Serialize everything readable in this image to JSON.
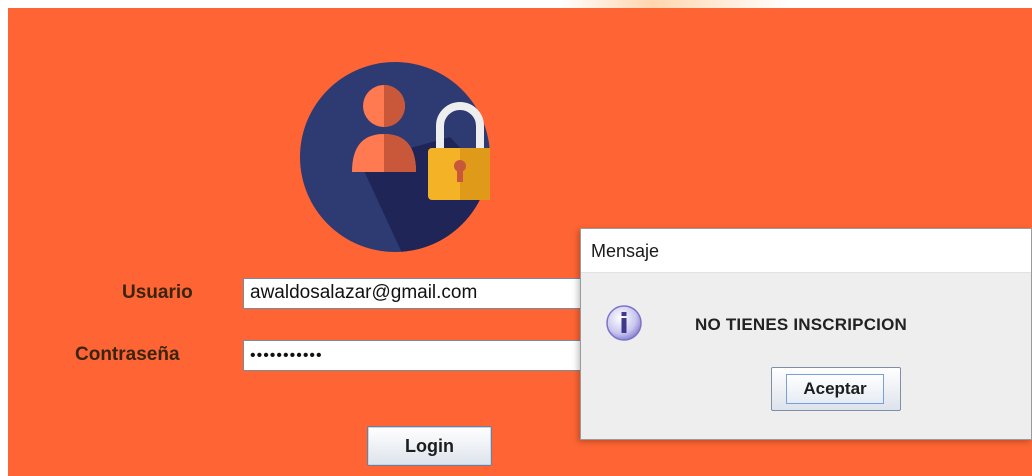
{
  "login": {
    "username_label": "Usuario",
    "username_value": "awaldosalazar@gmail.com",
    "password_label": "Contraseña",
    "password_mask": "•••••••••••",
    "login_button": "Login"
  },
  "dialog": {
    "title": "Mensaje",
    "message": "NO TIENES INSCRIPCION",
    "ok_button": "Aceptar",
    "icon": "info-icon"
  },
  "colors": {
    "background": "#ff6534",
    "avatar_circle": "#2e3a72",
    "avatar_shadow": "#1f2657",
    "user_figure": "#ff7a50",
    "lock_body": "#f4b326",
    "lock_shackle": "#eeeeee",
    "label_text": "#3a2410"
  }
}
